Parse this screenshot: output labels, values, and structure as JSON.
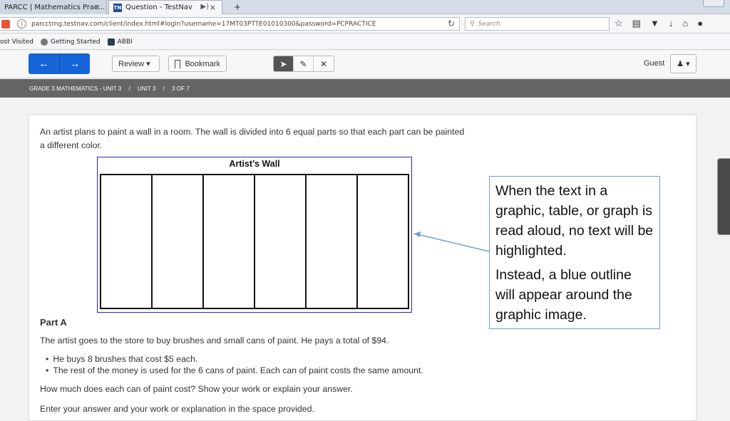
{
  "browser": {
    "tabs": [
      {
        "label": "PARCC | Mathematics Prac...",
        "active": false
      },
      {
        "label": "Question - TestNav",
        "active": true
      }
    ],
    "url": "parcctrng.testnav.com/client/index.html#login?username=17MT03PTTE01010300&password=PCPRACTICE",
    "search_placeholder": "Search",
    "bookmarks": [
      "ost Visited",
      "Getting Started",
      "ABBI"
    ],
    "tab_favicon": "TN"
  },
  "toolbar": {
    "review_label": "Review ▾",
    "bookmark_label": "Bookmark",
    "user_label": "Guest"
  },
  "breadcrumb": {
    "course": "GRADE 3 MATHEMATICS - UNIT 3",
    "unit": "UNIT 3",
    "position": "3 OF 7"
  },
  "question": {
    "intro": "An artist plans to paint a wall in a room. The wall is divided into 6 equal parts so that each part can be painted a different color.",
    "figure_title": "Artist’s Wall",
    "part_label": "Part A",
    "stem": "The artist goes to the store to buy brushes and small cans of paint. He pays a total of $94.",
    "bullets": [
      "He buys 8 brushes that cost $5 each.",
      "The rest of the money is used for the 6 cans of paint. Each can of paint costs the same amount."
    ],
    "prompt": "How much does each can of paint cost? Show your work or explain your answer.",
    "instructions": "Enter your answer and your work or explanation in the space provided."
  },
  "callout": {
    "line1": "When the text in a graphic, table, or graph is read aloud, no text will be highlighted.",
    "line2": "Instead, a blue outline will appear around the graphic image."
  },
  "colors": {
    "nav_button": "#1565d8",
    "figure_outline": "#2a2aa8",
    "callout_border": "#6fa0d4",
    "breadcrumb_bar": "#656565"
  }
}
